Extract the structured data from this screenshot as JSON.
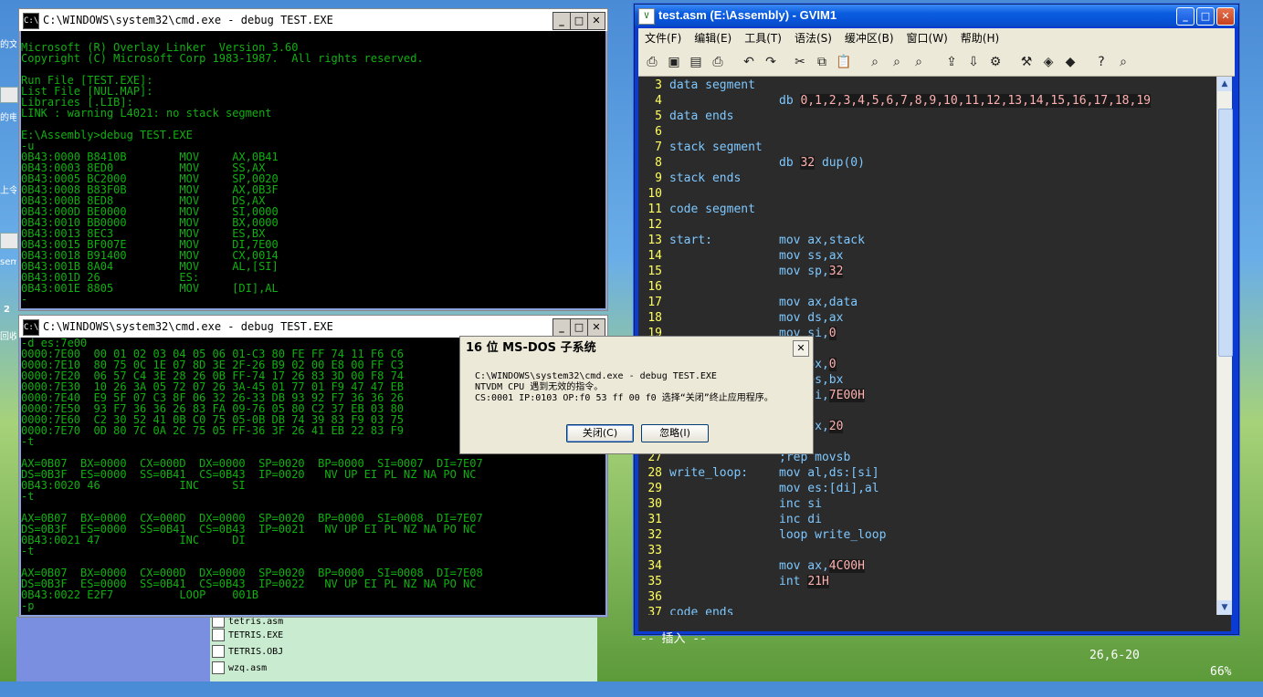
{
  "desktop": {
    "labels": [
      "的文",
      "的电",
      "上令",
      "sem",
      "2",
      "回收"
    ]
  },
  "explorer": {
    "files": [
      "tetris.asm",
      "TETRIS.EXE",
      "TETRIS.OBJ",
      "wzq.asm"
    ]
  },
  "cmd1": {
    "title": "C:\\WINDOWS\\system32\\cmd.exe - debug TEST.EXE",
    "lines": [
      "",
      "Microsoft (R) Overlay Linker  Version 3.60",
      "Copyright (C) Microsoft Corp 1983-1987.  All rights reserved.",
      "",
      "Run File [TEST.EXE]:",
      "List File [NUL.MAP]:",
      "Libraries [.LIB]:",
      "LINK : warning L4021: no stack segment",
      "",
      "E:\\Assembly>debug TEST.EXE",
      "-u",
      "0B43:0000 B8410B        MOV     AX,0B41",
      "0B43:0003 8ED0          MOV     SS,AX",
      "0B43:0005 BC2000        MOV     SP,0020",
      "0B43:0008 B83F0B        MOV     AX,0B3F",
      "0B43:000B 8ED8          MOV     DS,AX",
      "0B43:000D BE0000        MOV     SI,0000",
      "0B43:0010 BB0000        MOV     BX,0000",
      "0B43:0013 8EC3          MOV     ES,BX",
      "0B43:0015 BF007E        MOV     DI,7E00",
      "0B43:0018 B91400        MOV     CX,0014",
      "0B43:001B 8A04          MOV     AL,[SI]",
      "0B43:001D 26            ES:",
      "0B43:001E 8805          MOV     [DI],AL",
      "-"
    ]
  },
  "cmd2": {
    "title": "C:\\WINDOWS\\system32\\cmd.exe - debug TEST.EXE",
    "lines": [
      "-d es:7e00",
      "0000:7E00  00 01 02 03 04 05 06 01-C3 80 FE FF 74 11 F6 C6",
      "0000:7E10  80 75 0C 1E 07 8D 3E 2F-26 B9 02 00 E8 00 FF C3",
      "0000:7E20  06 57 C4 3E 28 26 0B FF-74 17 26 83 3D 00 F8 74",
      "0000:7E30  10 26 3A 05 72 07 26 3A-45 01 77 01 F9 47 47 EB",
      "0000:7E40  E9 5F 07 C3 8F 06 32 26-33 DB 93 92 F7 36 36 26",
      "0000:7E50  93 F7 36 36 26 83 FA 09-76 05 80 C2 37 EB 03 80",
      "0000:7E60  C2 30 52 41 0B C0 75 05-0B DB 74 39 83 F9 03 75",
      "0000:7E70  0D 80 7C 0A 2C 75 05 FF-36 3F 26 41 EB 22 83 F9",
      "-t",
      "",
      "AX=0B07  BX=0000  CX=000D  DX=0000  SP=0020  BP=0000  SI=0007  DI=7E07",
      "DS=0B3F  ES=0000  SS=0B41  CS=0B43  IP=0020   NV UP EI PL NZ NA PO NC",
      "0B43:0020 46            INC     SI",
      "-t",
      "",
      "AX=0B07  BX=0000  CX=000D  DX=0000  SP=0020  BP=0000  SI=0008  DI=7E07",
      "DS=0B3F  ES=0000  SS=0B41  CS=0B43  IP=0021   NV UP EI PL NZ NA PO NC",
      "0B43:0021 47            INC     DI",
      "-t",
      "",
      "AX=0B07  BX=0000  CX=000D  DX=0000  SP=0020  BP=0000  SI=0008  DI=7E08",
      "DS=0B3F  ES=0000  SS=0B41  CS=0B43  IP=0022   NV UP EI PL NZ NA PO NC",
      "0B43:0022 E2F7          LOOP    001B",
      "-p"
    ]
  },
  "gvim": {
    "title": "test.asm (E:\\Assembly) - GVIM1",
    "menu": [
      "文件(F)",
      "编辑(E)",
      "工具(T)",
      "语法(S)",
      "缓冲区(B)",
      "窗口(W)",
      "帮助(H)"
    ],
    "lines": [
      {
        "n": "3",
        "a": "data segment",
        "b": ""
      },
      {
        "n": "4",
        "a": "",
        "b": "db ",
        "nums": "0,1,2,3,4,5,6,7,8,9,10,11,12,13,14,15,16,17,18,19"
      },
      {
        "n": "5",
        "a": "data ends",
        "b": ""
      },
      {
        "n": "6",
        "a": "",
        "b": ""
      },
      {
        "n": "7",
        "a": "stack segment",
        "b": ""
      },
      {
        "n": "8",
        "a": "",
        "b": "db ",
        "nums": "32",
        "tail": " dup(0)"
      },
      {
        "n": "9",
        "a": "stack ends",
        "b": ""
      },
      {
        "n": "10",
        "a": "",
        "b": ""
      },
      {
        "n": "11",
        "a": "code segment",
        "b": ""
      },
      {
        "n": "12",
        "a": "",
        "b": ""
      },
      {
        "n": "13",
        "a": "start:",
        "b": "mov ax,stack"
      },
      {
        "n": "14",
        "a": "",
        "b": "mov ss,ax"
      },
      {
        "n": "15",
        "a": "",
        "b": "mov sp,",
        "nums": "32"
      },
      {
        "n": "16",
        "a": "",
        "b": ""
      },
      {
        "n": "17",
        "a": "",
        "b": "mov ax,data"
      },
      {
        "n": "18",
        "a": "",
        "b": "mov ds,ax"
      },
      {
        "n": "19",
        "a": "",
        "b": "mov si,",
        "nums": "0"
      },
      {
        "n": "20",
        "a": "",
        "b": ""
      },
      {
        "n": "21",
        "a": "",
        "b": "mov bx,",
        "nums": "0"
      },
      {
        "n": "22",
        "a": "",
        "b": "mov es,bx"
      },
      {
        "n": "23",
        "a": "",
        "b": "mov di,",
        "nums": "7E00H"
      },
      {
        "n": "24",
        "a": "",
        "b": ""
      },
      {
        "n": "25",
        "a": "",
        "b": "mov cx,",
        "nums": "20"
      },
      {
        "n": "26",
        "a": "",
        "b": ""
      },
      {
        "n": "27",
        "a": "",
        "b": ";rep movsb"
      },
      {
        "n": "28",
        "a": "write_loop:",
        "b": "mov al,ds:[si]"
      },
      {
        "n": "29",
        "a": "",
        "b": "mov es:[di],al"
      },
      {
        "n": "30",
        "a": "",
        "b": "inc si"
      },
      {
        "n": "31",
        "a": "",
        "b": "inc di"
      },
      {
        "n": "32",
        "a": "",
        "b": "loop write_loop"
      },
      {
        "n": "33",
        "a": "",
        "b": ""
      },
      {
        "n": "34",
        "a": "",
        "b": "mov ax,",
        "nums": "4C00H"
      },
      {
        "n": "35",
        "a": "",
        "b": "int ",
        "nums": "21H"
      },
      {
        "n": "36",
        "a": "",
        "b": ""
      },
      {
        "n": "37",
        "a": "code ends",
        "b": ""
      }
    ],
    "status": {
      "mode": "-- 插入 --",
      "pos": "26,6-20",
      "pct": "66%"
    }
  },
  "dialog": {
    "title": "16 位 MS-DOS 子系统",
    "line1": "C:\\WINDOWS\\system32\\cmd.exe - debug TEST.EXE",
    "line2": "NTVDM CPU 遇到无效的指令。",
    "line3": "CS:0001 IP:0103 OP:f0 53 ff 00 f0 选择“关闭”终止应用程序。",
    "close_label": "关闭(C)",
    "ignore_label": "忽略(I)"
  },
  "colors": {
    "console_text": "#10b010",
    "vim_bg": "#2b2b2b",
    "vim_line_nr": "#ffff60",
    "vim_text": "#7ec8ff",
    "vim_number": "#ffb0b0"
  }
}
